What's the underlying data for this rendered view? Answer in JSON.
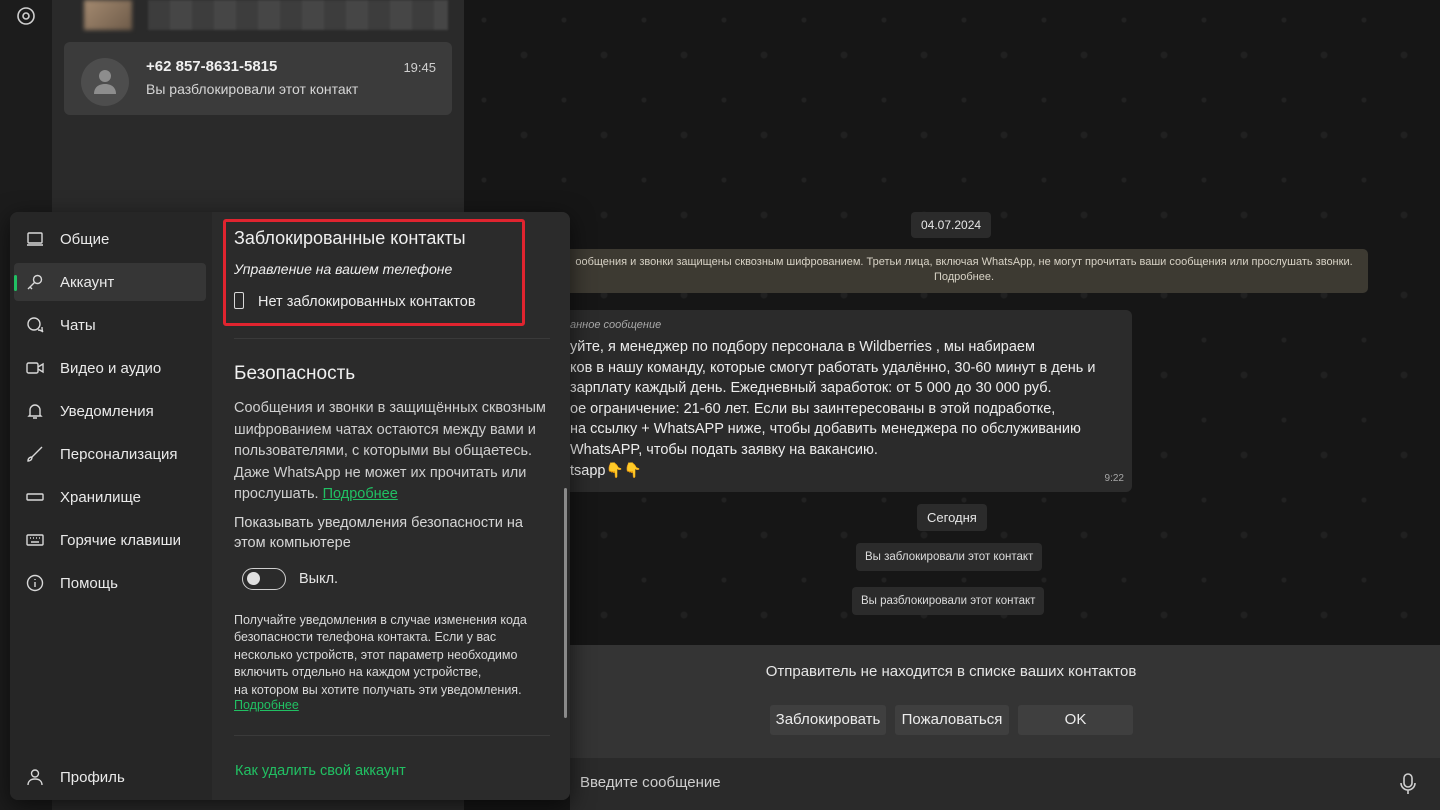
{
  "chat_list": {
    "item": {
      "name": "+62 857-8631-5815",
      "time": "19:45",
      "preview": "Вы разблокировали этот контакт"
    }
  },
  "chat": {
    "date1": "04.07.2024",
    "encryption_notice": "ообщения и звонки защищены сквозным шифрованием. Третьи лица, включая WhatsApp, не могут прочитать ваши сообщения или прослушать звонки. Подробнее.",
    "message": {
      "forwarded_label": "анное сообщение",
      "text": "уйте, я менеджер по подбору персонала в Wildberries , мы набираем\nков в нашу команду, которые смогут работать удалённо, 30-60 минут в день и\n зарплату каждый день. Ежедневный заработок: от 5 000 до 30 000 руб.\nое ограничение: 21-60 лет. Если вы заинтересованы в этой подработке,\n на ссылку + WhatsAPP  ниже, чтобы добавить менеджера по обслуживанию\n WhatsAPP, чтобы подать заявку на вакансию.\ntsapp👇👇",
      "time": "9:22"
    },
    "date2": "Сегодня",
    "sys_blocked": "Вы заблокировали этот контакт",
    "sys_unblocked": "Вы разблокировали этот контакт",
    "unknown_sender": {
      "text": "Отправитель не находится в списке ваших контактов",
      "block_label": "Заблокировать",
      "report_label": "Пожаловаться",
      "ok_label": "OK"
    },
    "composer_placeholder": "Введите сообщение"
  },
  "settings": {
    "nav": [
      {
        "label": "Общие",
        "icon": "laptop-icon"
      },
      {
        "label": "Аккаунт",
        "icon": "key-icon",
        "active": true
      },
      {
        "label": "Чаты",
        "icon": "chat-icon"
      },
      {
        "label": "Видео и аудио",
        "icon": "video-icon"
      },
      {
        "label": "Уведомления",
        "icon": "bell-icon"
      },
      {
        "label": "Персонализация",
        "icon": "brush-icon"
      },
      {
        "label": "Хранилище",
        "icon": "storage-icon"
      },
      {
        "label": "Горячие клавиши",
        "icon": "keyboard-icon"
      },
      {
        "label": "Помощь",
        "icon": "info-icon"
      }
    ],
    "profile_label": "Профиль",
    "blocked": {
      "title": "Заблокированные контакты",
      "subtitle": "Управление на вашем телефоне",
      "none": "Нет заблокированных контактов"
    },
    "security": {
      "title": "Безопасность",
      "desc": "Сообщения и звонки в защищённых сквозным шифрованием чатах остаются между вами и пользователями, с которыми вы общаетесь. Даже WhatsApp не может их прочитать или прослушать.",
      "more_link": "Подробнее",
      "notif_label": "Показывать уведомления безопасности на этом компьютере",
      "toggle_label": "Выкл.",
      "small_desc": "Получайте уведомления в случае изменения кода безопасности телефона контакта. Если у вас несколько устройств, этот параметр необходимо включить отдельно на каждом устройстве,\nна котором вы хотите получать эти уведомления.",
      "small_link": "Подробнее",
      "delete_link": "Как удалить свой аккаунт"
    }
  },
  "colors": {
    "accent": "#21c063",
    "highlight_border": "#e0242f"
  }
}
